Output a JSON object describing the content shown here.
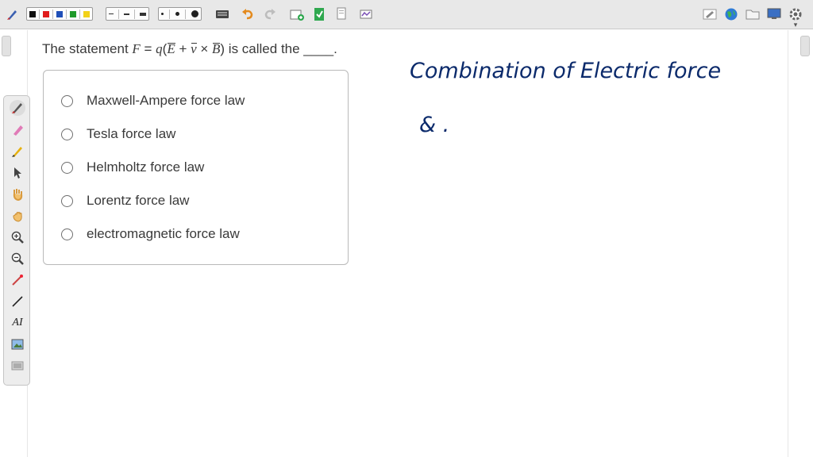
{
  "question": {
    "prefix": "The statement ",
    "F": "F",
    "eq": " = ",
    "q": "q",
    "open": "(",
    "E": "E",
    "plus": " + ",
    "v": "v",
    "times": " × ",
    "B": "B",
    "close": ")",
    "suffix": " is called the ____."
  },
  "answers": [
    {
      "label": "Maxwell-Ampere force law"
    },
    {
      "label": "Tesla force law"
    },
    {
      "label": "Helmholtz force law"
    },
    {
      "label": "Lorentz force law"
    },
    {
      "label": "electromagnetic force law"
    }
  ],
  "handwriting": {
    "line1": "Combination of Electric force",
    "line2": "& ."
  },
  "colors": {
    "ink": "#0b2a6b",
    "toolbar_bg": "#e8e8e8",
    "palette_bg": "#ededed"
  },
  "toolbar": {
    "pen_colors": [
      "#111111",
      "#e01b1b",
      "#1f4fb8",
      "#1f9a2a",
      "#f2d21a"
    ],
    "icons": [
      "pen-settings-icon",
      "undo-icon",
      "redo-icon",
      "keyboard-icon",
      "add-page-icon",
      "insert-file-icon",
      "copy-page-icon",
      "paste-page-icon",
      "handwriting-icon",
      "eraser-icon",
      "globe-icon",
      "folder-icon",
      "screen-icon",
      "settings-icon"
    ]
  },
  "palette": {
    "tools": [
      "pen-icon",
      "highlighter-icon",
      "eraser-icon",
      "pointer-icon",
      "pan-hand-icon",
      "grab-hand-icon",
      "zoom-in-icon",
      "zoom-out-icon",
      "laser-icon",
      "line-icon",
      "text-icon",
      "image-icon",
      "more-icon"
    ],
    "text_tool_label": "AI"
  }
}
